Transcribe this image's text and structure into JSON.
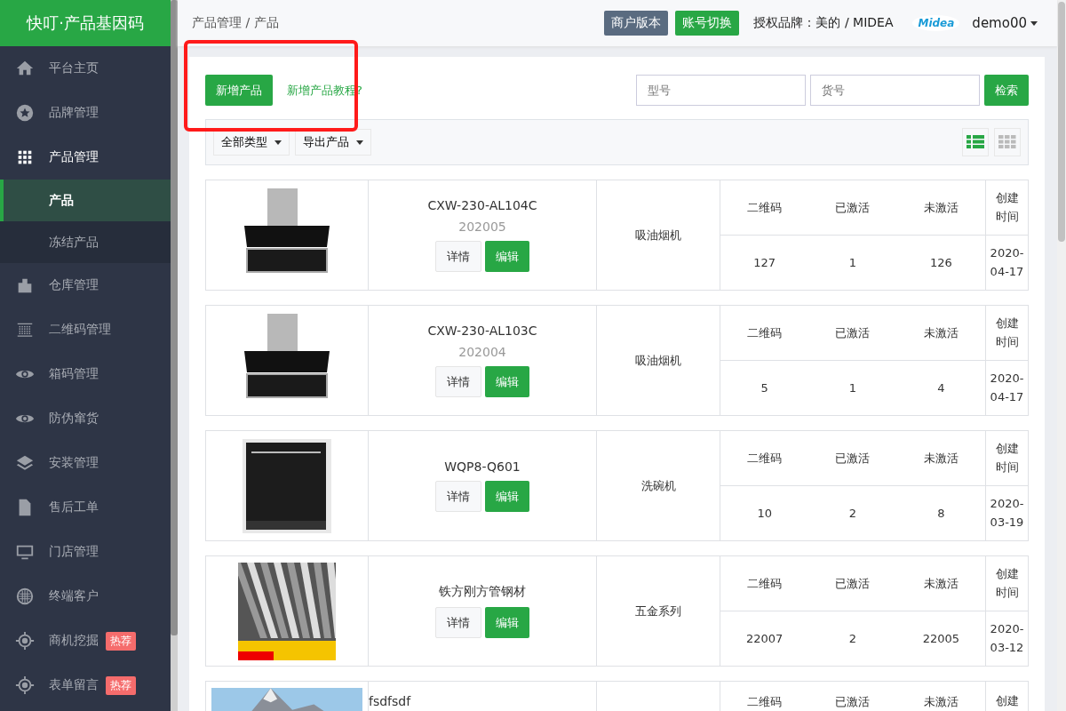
{
  "app_title": "快叮·产品基因码",
  "sidebar": {
    "items": [
      {
        "label": "平台主页",
        "expanded": false
      },
      {
        "label": "品牌管理",
        "expanded": false
      },
      {
        "label": "产品管理",
        "expanded": true,
        "children": [
          {
            "label": "产品",
            "selected": true
          },
          {
            "label": "冻结产品",
            "selected": false
          }
        ]
      },
      {
        "label": "仓库管理",
        "expanded": false
      },
      {
        "label": "二维码管理",
        "expanded": false
      },
      {
        "label": "箱码管理",
        "expanded": false
      },
      {
        "label": "防伪窜货",
        "expanded": false
      },
      {
        "label": "安装管理",
        "expanded": false
      },
      {
        "label": "售后工单",
        "expanded": false
      },
      {
        "label": "门店管理",
        "expanded": false
      },
      {
        "label": "终端客户",
        "expanded": false
      },
      {
        "label": "商机挖掘",
        "expanded": false,
        "badge": "热荐"
      },
      {
        "label": "表单留言",
        "expanded": false,
        "badge": "热荐"
      }
    ]
  },
  "header": {
    "breadcrumb": "产品管理 / 产品",
    "buttons": [
      {
        "label": "商户版本",
        "kind": "secondary"
      },
      {
        "label": "账号切换",
        "kind": "primary"
      }
    ],
    "brand": "授权品牌：美的 / MIDEA",
    "brand_logo": "Midea",
    "user": "demo00"
  },
  "toolbar": {
    "add_button": "新增产品",
    "tutorial_link": "新增产品教程?",
    "search_fields": [
      {
        "placeholder": "型号"
      },
      {
        "placeholder": "货号"
      }
    ],
    "search_button": "检索"
  },
  "filter_bar": {
    "dropdowns": [
      "全部类型",
      "导出产品"
    ],
    "views": [
      {
        "kind": "list",
        "selected": true
      },
      {
        "kind": "grid",
        "selected": false
      }
    ]
  },
  "annotation": {
    "kind": "box",
    "color": "#ff1a1a"
  },
  "products": [
    {
      "kind": "hood",
      "name": "CXW-230-AL104C",
      "code": "202005",
      "actions": [
        "详情",
        "编辑"
      ],
      "category": "吸油烟机",
      "stats": [
        {
          "label": "二维码",
          "value": "127"
        },
        {
          "label": "已激活",
          "value": "1"
        },
        {
          "label": "未激活",
          "value": "126"
        }
      ],
      "created_label": "创建时间",
      "created": "2020-04-17"
    },
    {
      "kind": "hood",
      "name": "CXW-230-AL103C",
      "code": "202004",
      "actions": [
        "详情",
        "编辑"
      ],
      "category": "吸油烟机",
      "stats": [
        {
          "label": "二维码",
          "value": "5"
        },
        {
          "label": "已激活",
          "value": "1"
        },
        {
          "label": "未激活",
          "value": "4"
        }
      ],
      "created_label": "创建时间",
      "created": "2020-04-17"
    },
    {
      "kind": "dishwasher",
      "name": "WQP8-Q601",
      "actions": [
        "详情",
        "编辑"
      ],
      "category": "洗碗机",
      "stats": [
        {
          "label": "二维码",
          "value": "10"
        },
        {
          "label": "已激活",
          "value": "2"
        },
        {
          "label": "未激活",
          "value": "8"
        }
      ],
      "created_label": "创建时间",
      "created": "2020-03-19"
    },
    {
      "kind": "steel",
      "name": "铁方刚方管钢材",
      "actions": [
        "详情",
        "编辑"
      ],
      "category": "五金系列",
      "stats": [
        {
          "label": "二维码",
          "value": "22007"
        },
        {
          "label": "已激活",
          "value": "2"
        },
        {
          "label": "未激活",
          "value": "22005"
        }
      ],
      "created_label": "创建时间",
      "created": "2020-03-12"
    },
    {
      "kind": "landscape",
      "name": "fsdfsdf",
      "stats": [
        {
          "label": "二维码"
        },
        {
          "label": "已激活"
        },
        {
          "label": "未激活"
        }
      ],
      "created_label": "创建"
    }
  ]
}
